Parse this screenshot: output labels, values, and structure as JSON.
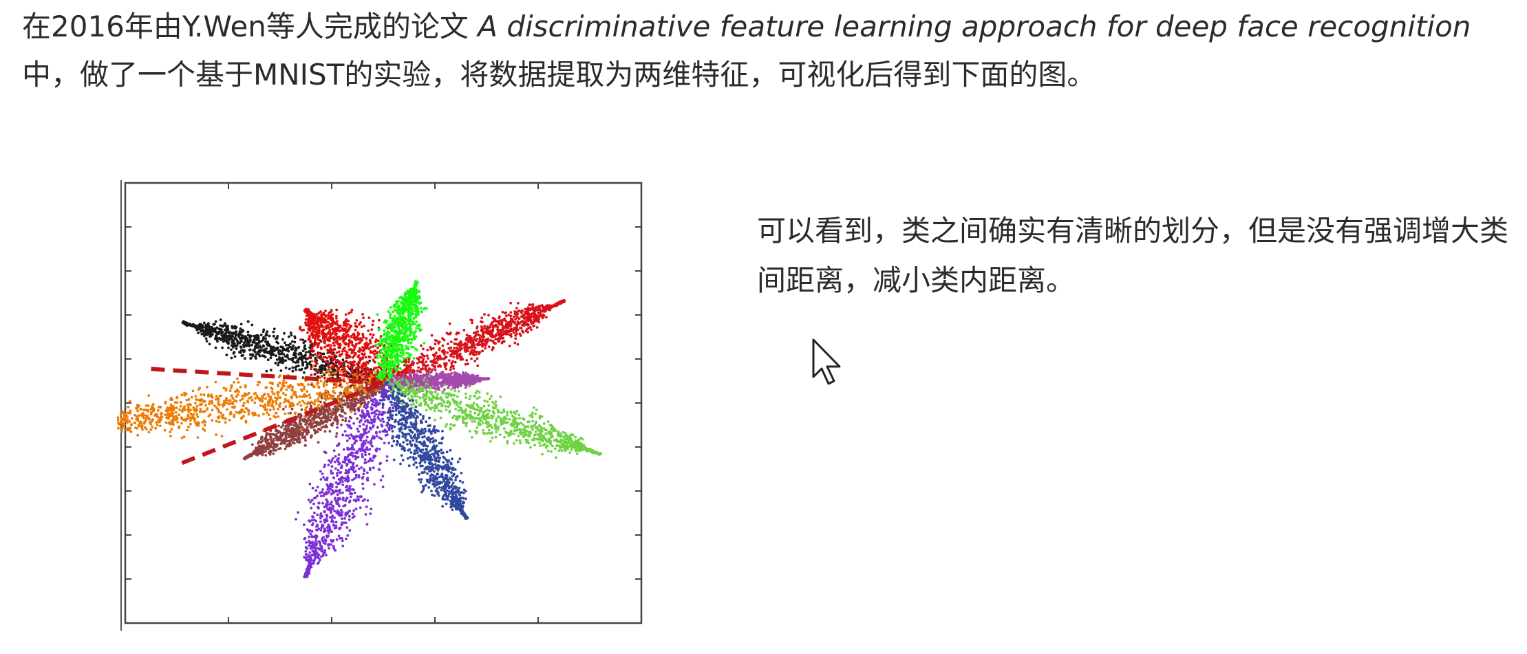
{
  "intro": {
    "before": "在2016年由Y.Wen等人完成的论文 ",
    "paper_title": "A discriminative feature learning approach for deep face recognition",
    "after": " 中，做了一个基于MNIST的实验，将数据提取为两维特征，可视化后得到下面的图。"
  },
  "side_note": "可以看到，类之间确实有清晰的划分，但是没有强调增大类间距离，减小类内距离。",
  "colors": {
    "text": "#2b2b2b",
    "dashed_line": "#c0161c",
    "classes": [
      "#ec7c05",
      "#8e4140",
      "#7c2fd6",
      "#31489f",
      "#6ed244",
      "#a44aac",
      "#d8121b",
      "#1bfa10",
      "#e01010",
      "#1a1a1a"
    ]
  },
  "icons": {
    "cursor": "mouse-pointer-icon"
  },
  "chart_data": {
    "type": "scatter",
    "title": "",
    "xlabel": "",
    "ylabel": "",
    "grid": false,
    "legend": "none",
    "xlim": [
      -1,
      1
    ],
    "ylim": [
      -1.2,
      1
    ],
    "center": [
      0,
      0
    ],
    "clusters": [
      {
        "color": "#1a1a1a",
        "tip": [
          -0.72,
          0.28
        ],
        "width": 0.075
      },
      {
        "color": "#e01010",
        "tip": [
          -0.28,
          0.34
        ],
        "width": 0.12
      },
      {
        "color": "#1bfa10",
        "tip": [
          0.12,
          0.47
        ],
        "width": 0.06
      },
      {
        "color": "#d8121b",
        "tip": [
          0.65,
          0.38
        ],
        "width": 0.07
      },
      {
        "color": "#a44aac",
        "tip": [
          0.38,
          0.02
        ],
        "width": 0.035
      },
      {
        "color": "#6ed244",
        "tip": [
          0.78,
          -0.33
        ],
        "width": 0.08
      },
      {
        "color": "#31489f",
        "tip": [
          0.3,
          -0.63
        ],
        "width": 0.075
      },
      {
        "color": "#7c2fd6",
        "tip": [
          -0.28,
          -0.9
        ],
        "width": 0.095
      },
      {
        "color": "#8e4140",
        "tip": [
          -0.5,
          -0.35
        ],
        "width": 0.06
      },
      {
        "color": "#ec7c05",
        "tip": [
          -1.06,
          -0.2
        ],
        "width": 0.1
      }
    ],
    "annotations": [
      {
        "type": "dashed-line",
        "color": "#c0161c",
        "from": [
          -0.9,
          0.07
        ],
        "to": [
          0,
          0
        ]
      },
      {
        "type": "dashed-line",
        "color": "#c0161c",
        "from": [
          -0.78,
          -0.4
        ],
        "to": [
          0,
          0
        ]
      }
    ]
  }
}
